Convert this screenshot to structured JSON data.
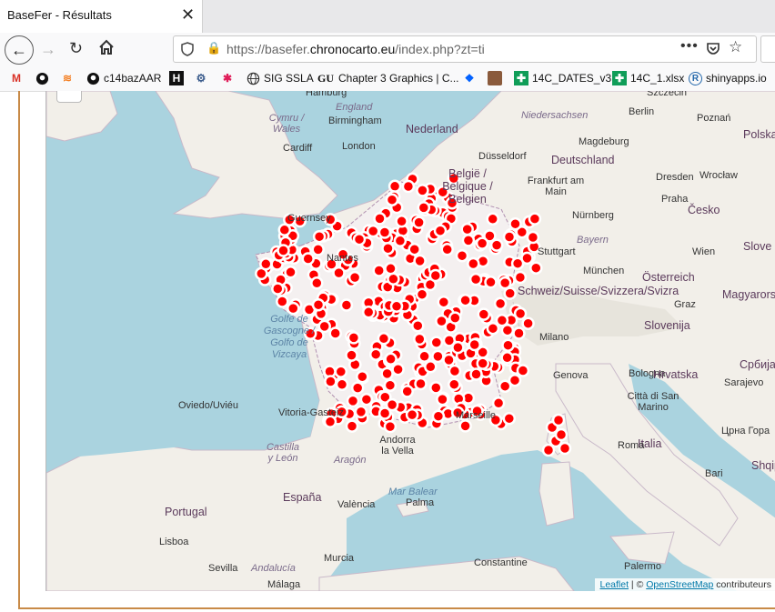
{
  "tab": {
    "title": "BaseFer - Résultats",
    "close": "✕"
  },
  "nav": {
    "url_prefix": "https://basefer.",
    "url_domain": "chronocarto.eu",
    "url_suffix": "/index.php?zt=ti",
    "more": "•••"
  },
  "bookmarks": [
    {
      "label": "",
      "icon": "gmail-icon"
    },
    {
      "label": "",
      "icon": "github-icon"
    },
    {
      "label": "",
      "icon": "stackoverflow-icon"
    },
    {
      "label": "c14bazAAR",
      "icon": "github-icon"
    },
    {
      "label": "",
      "icon": "hackernews-icon"
    },
    {
      "label": "",
      "icon": "gear-icon"
    },
    {
      "label": "",
      "icon": "slack-icon"
    },
    {
      "label": "SIG SSLA",
      "icon": "globe-icon"
    },
    {
      "label": "Chapter 3 Graphics | C...",
      "icon": "guardian-icon"
    },
    {
      "label": "",
      "icon": "dropbox-icon"
    },
    {
      "label": "",
      "icon": "avatar-icon"
    },
    {
      "label": "14C_DATES_v3",
      "icon": "sheets-icon"
    },
    {
      "label": "14C_1.xlsx",
      "icon": "sheets-icon"
    },
    {
      "label": "shinyapps.io",
      "icon": "r-icon"
    }
  ],
  "map": {
    "labels": {
      "cities": [
        "Hamburg",
        "Szczecin",
        "Berlin",
        "Poznań",
        "Nederland",
        "Birmingham",
        "Cardiff",
        "London",
        "Düsseldorf",
        "Magdeburg",
        "Deutschland",
        "Dresden",
        "Wrocław",
        "Frankfurt am Main",
        "Praha",
        "Česko",
        "Nürnberg",
        "Stuttgart",
        "München",
        "Wien",
        "Österreich",
        "Graz",
        "Slovenija",
        "Milano",
        "Genova",
        "Bologna",
        "Hrvatska",
        "Sarajevo",
        "Città di San Marino",
        "Italia",
        "Roma",
        "Bari",
        "Oviedo/Uviéu",
        "Vitoria-Gasteiz",
        "Andorra la Vella",
        "España",
        "València",
        "Palma",
        "Portugal",
        "Lisboa",
        "Sevilla",
        "Málaga",
        "Murcia",
        "Palermo",
        "Constantine",
        "Marseille",
        "Nantes",
        "Guernsey",
        "Schweiz/Suisse/Svizzera/Svizra",
        "België / Belgique / Belgien",
        "Magyarország",
        "Polska",
        "Slove",
        "Србија",
        "Црна Гора",
        "Shqip"
      ],
      "seas": [
        "Golfe de Gascogne / Golfo de Vizcaya",
        "Mar Balear"
      ],
      "regions": [
        "Cymru / Wales",
        "England",
        "Niedersachsen",
        "Bayern",
        "Castilla y León",
        "Aragón",
        "Andalucía"
      ]
    },
    "attribution": {
      "leaflet": "Leaflet",
      "sep": " | © ",
      "osm": "OpenStreetMap",
      "suffix": " contributeurs"
    }
  }
}
